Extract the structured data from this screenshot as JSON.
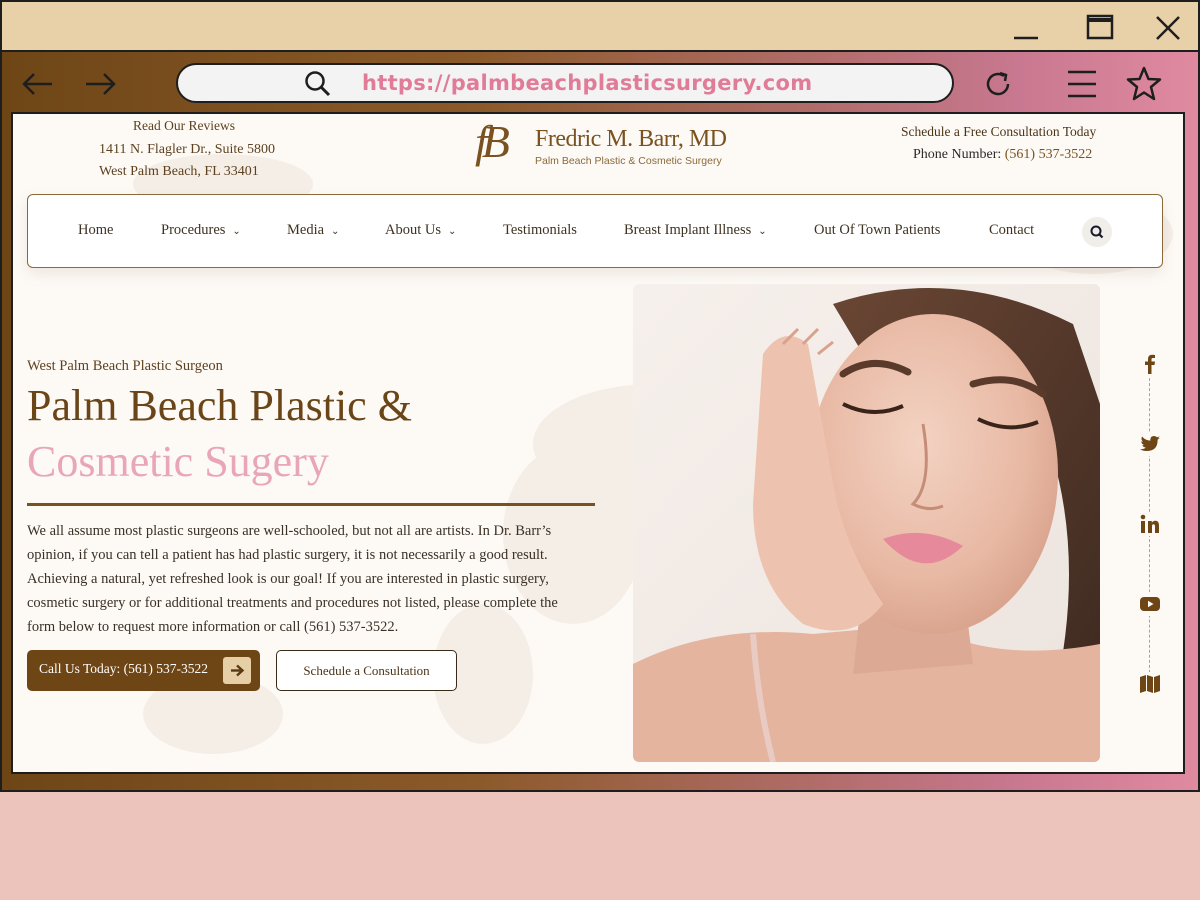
{
  "browser": {
    "url": "https://palmbeachplasticsurgery.com",
    "window_controls": [
      "minimize-icon",
      "maximize-icon",
      "close-icon"
    ],
    "toolbar_icons": [
      "back-arrow-icon",
      "forward-arrow-icon",
      "search-icon",
      "reload-icon",
      "hamburger-menu-icon",
      "star-icon"
    ]
  },
  "header": {
    "reviews_link": "Read Our Reviews",
    "address_line1": "1411 N. Flagler Dr., Suite 5800",
    "address_line2": "West Palm Beach, FL 33401",
    "logo_mark": "fB",
    "logo_name": "Fredric M. Barr, MD",
    "logo_subtitle": "Palm Beach Plastic & Cosmetic Surgery",
    "consult_text": "Schedule a Free Consultation Today",
    "phone_label": "Phone Number:",
    "phone_number": "(561) 537-3522"
  },
  "nav": {
    "items": [
      {
        "label": "Home",
        "has_dropdown": false
      },
      {
        "label": "Procedures",
        "has_dropdown": true
      },
      {
        "label": "Media",
        "has_dropdown": true
      },
      {
        "label": "About Us",
        "has_dropdown": true
      },
      {
        "label": "Testimonials",
        "has_dropdown": false
      },
      {
        "label": "Breast Implant Illness",
        "has_dropdown": true
      },
      {
        "label": "Out Of Town Patients",
        "has_dropdown": false
      },
      {
        "label": "Contact",
        "has_dropdown": false
      }
    ],
    "chevron": "⌄"
  },
  "hero": {
    "eyebrow": "West Palm Beach Plastic Surgeon",
    "title_line1": "Palm Beach Plastic &",
    "title_line2": "Cosmetic Sugery",
    "body": "We all assume most plastic surgeons are well-schooled, but not all are artists. In Dr. Barr’s opinion, if you can tell a patient has had plastic surgery, it is not necessarily a good result. Achieving a natural, yet refreshed look is our goal! If you are interested in plastic surgery, cosmetic surgery or for additional treatments and procedures not listed, please complete the form below to request more information or call (561) 537-3522.",
    "call_button": "Call Us Today: (561) 537-3522",
    "schedule_button": "Schedule a Consultation"
  },
  "social": [
    "facebook-icon",
    "twitter-icon",
    "linkedin-icon",
    "youtube-icon",
    "map-icon"
  ],
  "colors": {
    "brand_brown": "#6e4616",
    "accent_pink": "#e8a6b8",
    "url_pink": "#e07c98",
    "titlebar": "#e8d0a8"
  }
}
